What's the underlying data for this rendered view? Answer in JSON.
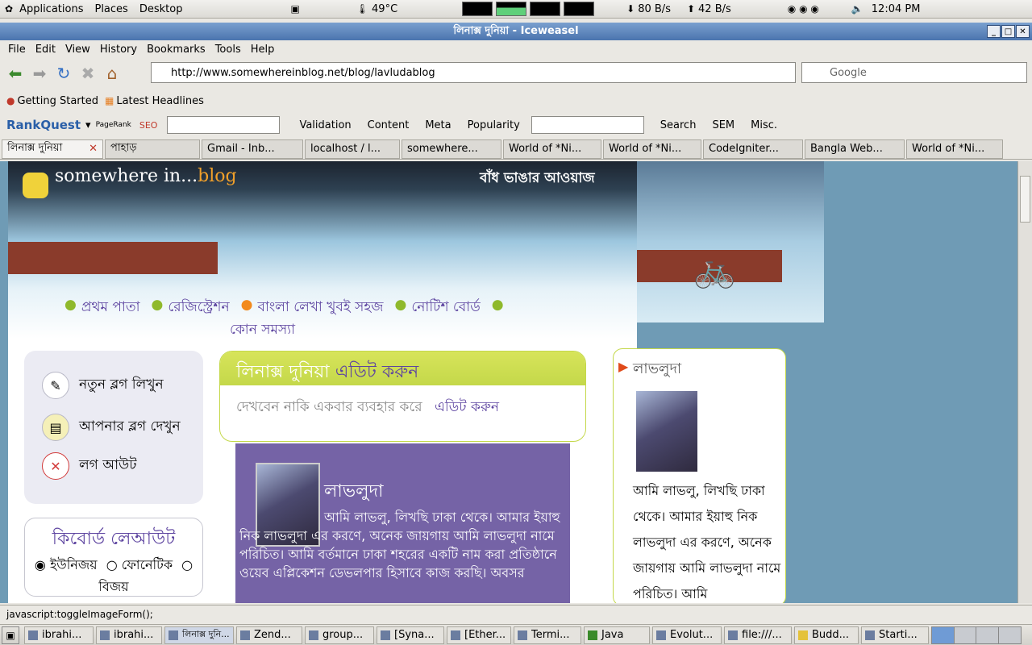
{
  "gnome_panel": {
    "menus": [
      "Applications",
      "Places",
      "Desktop"
    ],
    "temperature": "49°C",
    "net_down": "80 B/s",
    "net_up": "42 B/s",
    "clock": "12:04 PM"
  },
  "window": {
    "title": "লিনাক্স দুনিয়া - Iceweasel"
  },
  "menubar": [
    "File",
    "Edit",
    "View",
    "History",
    "Bookmarks",
    "Tools",
    "Help"
  ],
  "navbar": {
    "url": "http://www.somewhereinblog.net/blog/lavludablog",
    "search_placeholder": "Google"
  },
  "bookmarks": [
    "Getting Started",
    "Latest Headlines"
  ],
  "rankquest": {
    "brand": "RankQuest",
    "pagerank": "PageRank",
    "seo": "SEO",
    "menus": [
      "Validation",
      "Content",
      "Meta",
      "Popularity"
    ],
    "search": "Search",
    "sem": "SEM",
    "misc": "Misc."
  },
  "tabs": [
    "লিনাক্স দুনিয়া",
    "পাহাড়",
    "Gmail - Inb...",
    "localhost / l...",
    "somewhere...",
    "World of *Ni...",
    "World of *Ni...",
    "CodeIgniter...",
    "Bangla Web...",
    "World of *Ni..."
  ],
  "page": {
    "logo": "somewhere in...",
    "logo_accent": "blog",
    "tagline": "বাঁধ ভাঙার আওয়াজ",
    "nav": [
      "প্রথম পাতা",
      "রেজিস্ট্রেশন",
      "বাংলা লেখা খুবই সহজ",
      "নোটিশ বোর্ড",
      "কোন সমস্যা"
    ],
    "left_menu": [
      "নতুন ব্লগ লিখুন",
      "আপনার ব্লগ দেখুন",
      "লগ আউট"
    ],
    "keyboard": {
      "title": "কিবোর্ড লেআউট",
      "options": [
        "ইউনিজয়",
        "ফোনেটিক",
        "বিজয়"
      ]
    },
    "edit_card": {
      "title": "লিনাক্স দুনিয়া",
      "title_link": "এডিট করুন",
      "text": "দেখবেন নাকি একবার ব্যবহার করে",
      "link": "এডিট করুন"
    },
    "profile": {
      "name": "লাভলুদা",
      "bio": "আমি লাভলু, লিখছি ঢাকা থেকে। আমার ইয়াহু নিক লাভলুদা এর করণে, অনেক জায়গায় আমি লাভলুদা নামে পরিচিত। আমি বর্তমানে ঢাকা শহরের একটি নাম করা প্রতিষ্ঠানে ওয়েব এপ্লিকেশন ডেভলপার হিসাবে কাজ করছি। অবসর"
    },
    "right_sidebar": {
      "title": "লাভলুদা",
      "bio": "আমি লাভলু, লিখছি ঢাকা থেকে। আমার ইয়াহু নিক লাভলুদা এর করণে, অনেক জায়গায় আমি লাভলুদা নামে পরিচিত। আমি"
    }
  },
  "status": "javascript:toggleImageForm();",
  "taskbar": [
    "ibrahi...",
    "ibrahi...",
    "লিনাক্স দুনি...",
    "Zend...",
    "group...",
    "[Syna...",
    "[Ether...",
    "Termi...",
    "Java",
    "Evolut...",
    "file:///...",
    "Budd...",
    "Starti..."
  ]
}
